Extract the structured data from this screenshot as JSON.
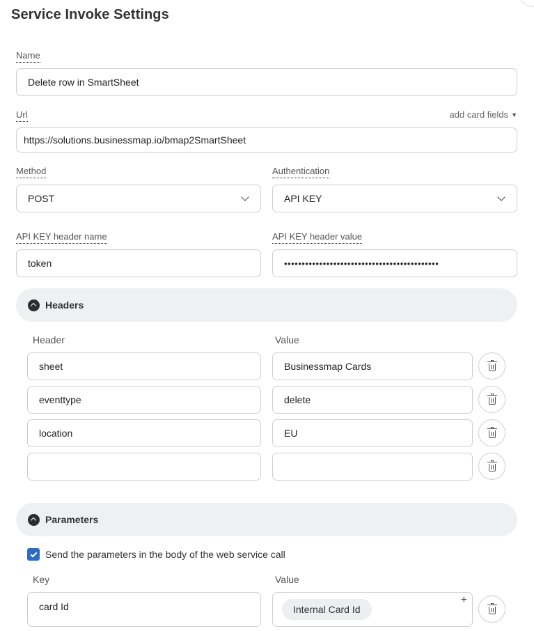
{
  "title": "Service Invoke Settings",
  "name": {
    "label": "Name",
    "value": "Delete row in SmartSheet"
  },
  "url": {
    "label": "Url",
    "value": "https://solutions.businessmap.io/bmap2SmartSheet",
    "add_fields": "add card fields"
  },
  "method": {
    "label": "Method",
    "value": "POST"
  },
  "authentication": {
    "label": "Authentication",
    "value": "API KEY"
  },
  "api_key_header_name": {
    "label": "API KEY header name",
    "value": "token"
  },
  "api_key_header_value": {
    "label": "API KEY header value",
    "value": "••••••••••••••••••••••••••••••••••••••••••••"
  },
  "headers": {
    "title": "Headers",
    "col_key": "Header",
    "col_value": "Value",
    "rows": [
      {
        "key": "sheet",
        "value": "Businessmap Cards"
      },
      {
        "key": "eventtype",
        "value": "delete"
      },
      {
        "key": "location",
        "value": "EU"
      },
      {
        "key": "",
        "value": ""
      }
    ]
  },
  "parameters": {
    "title": "Parameters",
    "send_in_body_label": "Send the parameters in the body of the web service call",
    "send_in_body_checked": true,
    "col_key": "Key",
    "col_value": "Value",
    "rows": [
      {
        "key": "card Id",
        "value_chip": "Internal Card Id"
      }
    ]
  },
  "icons": {
    "collapse": "chevron-up-circle-icon",
    "delete": "trash-icon",
    "dropdown": "chevron-down-icon",
    "add": "plus-icon"
  },
  "colors": {
    "accent": "#2d6cc4",
    "section_bg": "#eef0f2"
  }
}
